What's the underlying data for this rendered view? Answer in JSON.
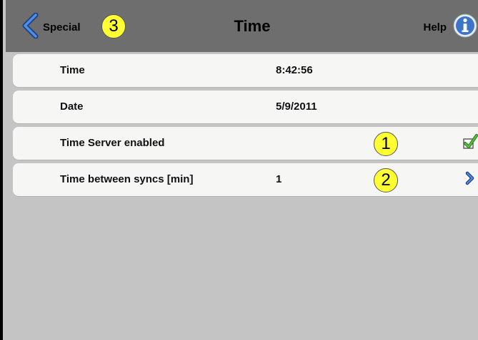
{
  "header": {
    "back_label": "Special",
    "title": "Time",
    "help_label": "Help",
    "back_callout": "3"
  },
  "rows": [
    {
      "label": "Time",
      "value": "8:42:56"
    },
    {
      "label": "Date",
      "value": "5/9/2011"
    },
    {
      "label": "Time Server enabled",
      "value": "",
      "callout": "1",
      "checked": true,
      "control_icon": "checkmark-icon"
    },
    {
      "label": "Time between syncs [min]",
      "value": "1",
      "callout": "2",
      "control_icon": "chevron-right-icon"
    }
  ],
  "colors": {
    "header_bg": "#6e6e6e",
    "body_bg": "#c4c4c4",
    "row_bg": "#f6f6f4",
    "accent_blue": "#2f6fc4",
    "check_green": "#3c9a2a",
    "callout_yellow": "#ffff33"
  }
}
